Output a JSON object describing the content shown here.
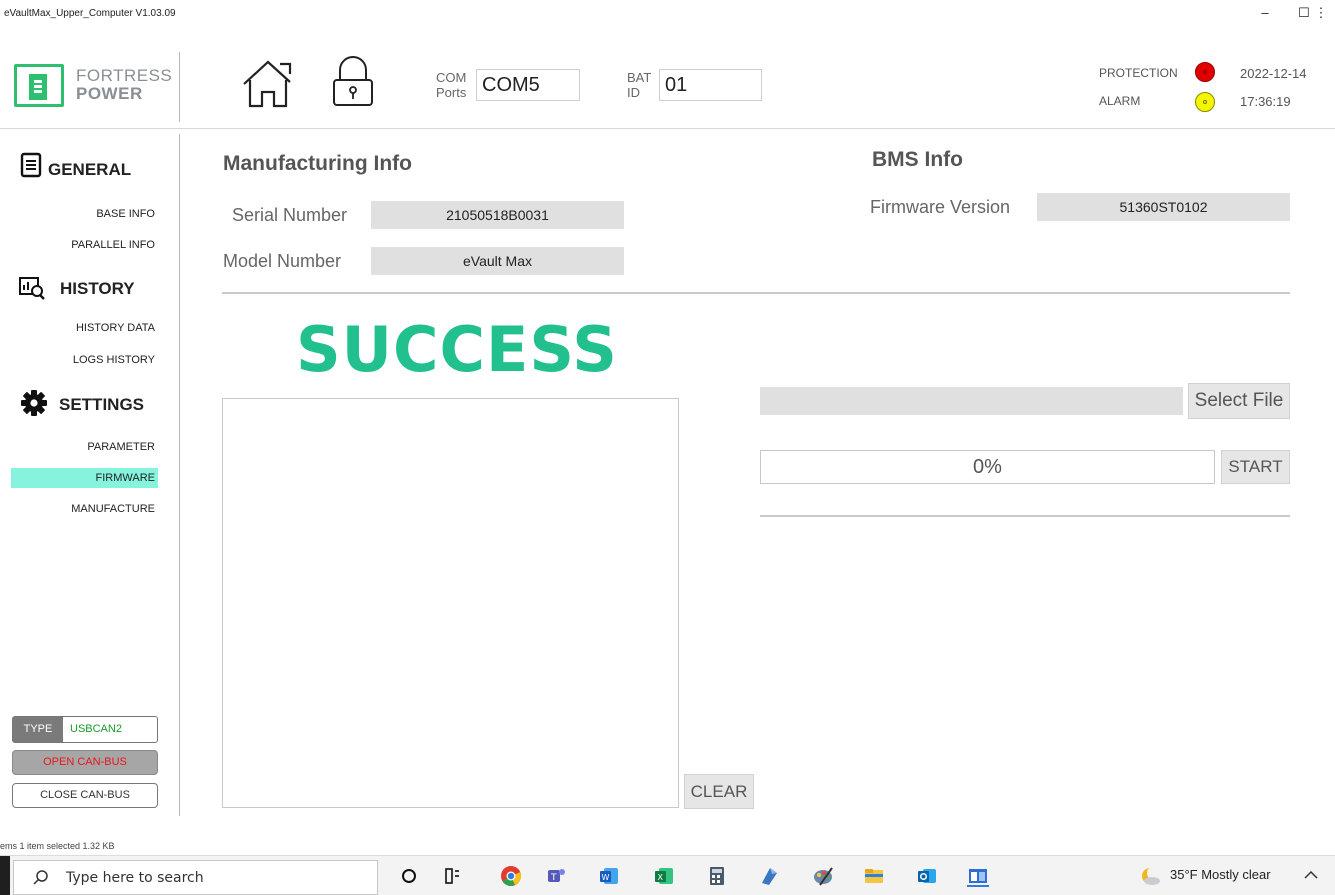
{
  "window": {
    "title": "eVaultMax_Upper_Computer V1.03.09",
    "minimize_glyph": "–",
    "maximize_glyph": "☐",
    "close_glyph": "⋮"
  },
  "logo": {
    "line1": "FORTRESS",
    "line2": "POWER"
  },
  "header": {
    "com_label_1": "COM",
    "com_label_2": "Ports",
    "com_value": "COM5",
    "bat_label_1": "BAT",
    "bat_label_2": "ID",
    "bat_value": "01",
    "protection_label": "PROTECTION",
    "alarm_label": "ALARM",
    "date": "2022-12-14",
    "time": "17:36:19",
    "icons": [
      "home-icon",
      "lock-icon"
    ]
  },
  "sidebar": {
    "general": {
      "label": "GENERAL",
      "items": [
        {
          "label": "BASE INFO"
        },
        {
          "label": "PARALLEL INFO"
        }
      ]
    },
    "history": {
      "label": "HISTORY",
      "items": [
        {
          "label": "HISTORY DATA"
        },
        {
          "label": "LOGS HISTORY"
        }
      ]
    },
    "settings": {
      "label": "SETTINGS",
      "items": [
        {
          "label": "PARAMETER"
        },
        {
          "label": "FIRMWARE",
          "active": true
        },
        {
          "label": "MANUFACTURE"
        }
      ]
    }
  },
  "manufacturing": {
    "title": "Manufacturing Info",
    "serial_label": "Serial Number",
    "serial_value": "21050518B0031",
    "model_label": "Model Number",
    "model_value": "eVault Max"
  },
  "bms": {
    "title": "BMS Info",
    "firmware_label": "Firmware Version",
    "firmware_value": "51360ST0102"
  },
  "firmware": {
    "status_text": "SUCCESS",
    "status_color": "#21c08e",
    "file_path": "",
    "select_file_label": "Select File",
    "progress_fraction": 0,
    "progress_text": "0%",
    "start_label": "START",
    "clear_label": "CLEAR",
    "log_text": ""
  },
  "canbus": {
    "type_label": "TYPE",
    "type_value": "USBCAN2",
    "open_label": "OPEN CAN-BUS",
    "close_label": "CLOSE CAN-BUS"
  },
  "explorer_strip": {
    "text": "ems    1 item selected  1.32 KB"
  },
  "taskbar": {
    "search_placeholder": "Type here to search",
    "weather": "35°F  Mostly clear",
    "pinned": [
      "cortana-icon",
      "task-view-icon",
      "chrome-icon",
      "teams-icon",
      "word-icon",
      "excel-icon",
      "calculator-icon",
      "app-icon",
      "paint-icon",
      "file-explorer-icon",
      "outlook-icon",
      "app-window-icon"
    ]
  },
  "colors": {
    "accent_green": "#21c08e",
    "nav_active": "#86f3df",
    "protection_led": "#e10000",
    "alarm_led": "#f5f500",
    "open_can_text": "#e8151b"
  }
}
